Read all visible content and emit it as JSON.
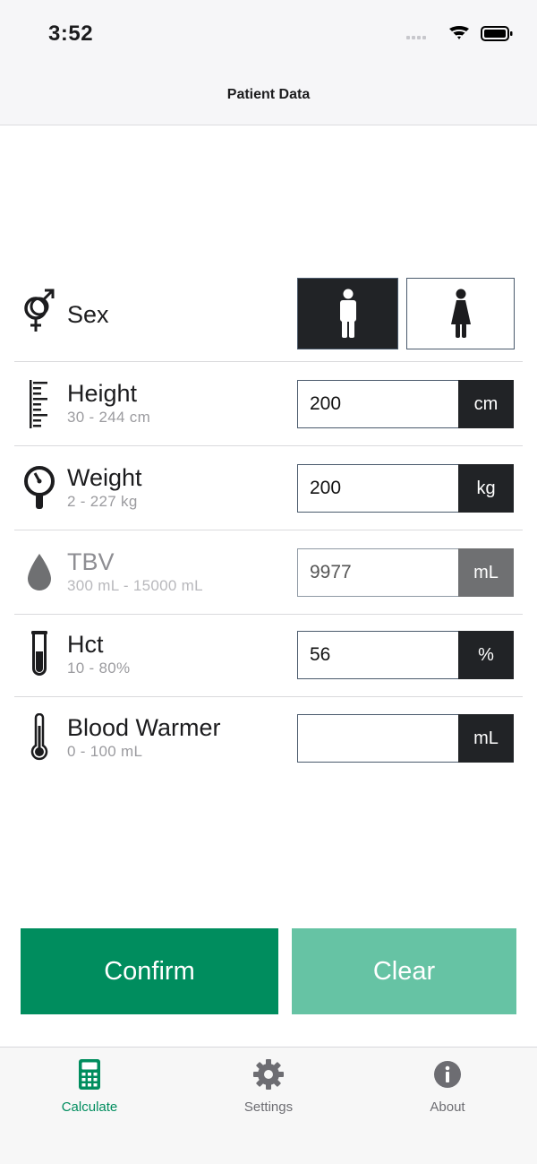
{
  "status_bar": {
    "time": "3:52"
  },
  "nav": {
    "title": "Patient Data"
  },
  "colors": {
    "accent": "#008d5e",
    "accent_light": "#66c3a4",
    "dark": "#212326",
    "disabled_unit": "#6f7072"
  },
  "sex": {
    "label": "Sex",
    "selected": "male"
  },
  "fields": [
    {
      "id": "height",
      "label": "Height",
      "range": "30 - 244 cm",
      "value": "200",
      "unit": "cm",
      "enabled": true
    },
    {
      "id": "weight",
      "label": "Weight",
      "range": "2 - 227 kg",
      "value": "200",
      "unit": "kg",
      "enabled": true
    },
    {
      "id": "tbv",
      "label": "TBV",
      "range": "300 mL - 15000 mL",
      "value": "9977",
      "unit": "mL",
      "enabled": false
    },
    {
      "id": "hct",
      "label": "Hct",
      "range": "10 - 80%",
      "value": "56",
      "unit": "%",
      "enabled": true
    },
    {
      "id": "blood_warmer",
      "label": "Blood Warmer",
      "range": "0 - 100 mL",
      "value": "",
      "unit": "mL",
      "enabled": true
    }
  ],
  "buttons": {
    "confirm": "Confirm",
    "clear": "Clear"
  },
  "tabs": [
    {
      "label": "Calculate",
      "icon": "calculator-icon",
      "active": true
    },
    {
      "label": "Settings",
      "icon": "gear-icon",
      "active": false
    },
    {
      "label": "About",
      "icon": "info-icon",
      "active": false
    }
  ]
}
